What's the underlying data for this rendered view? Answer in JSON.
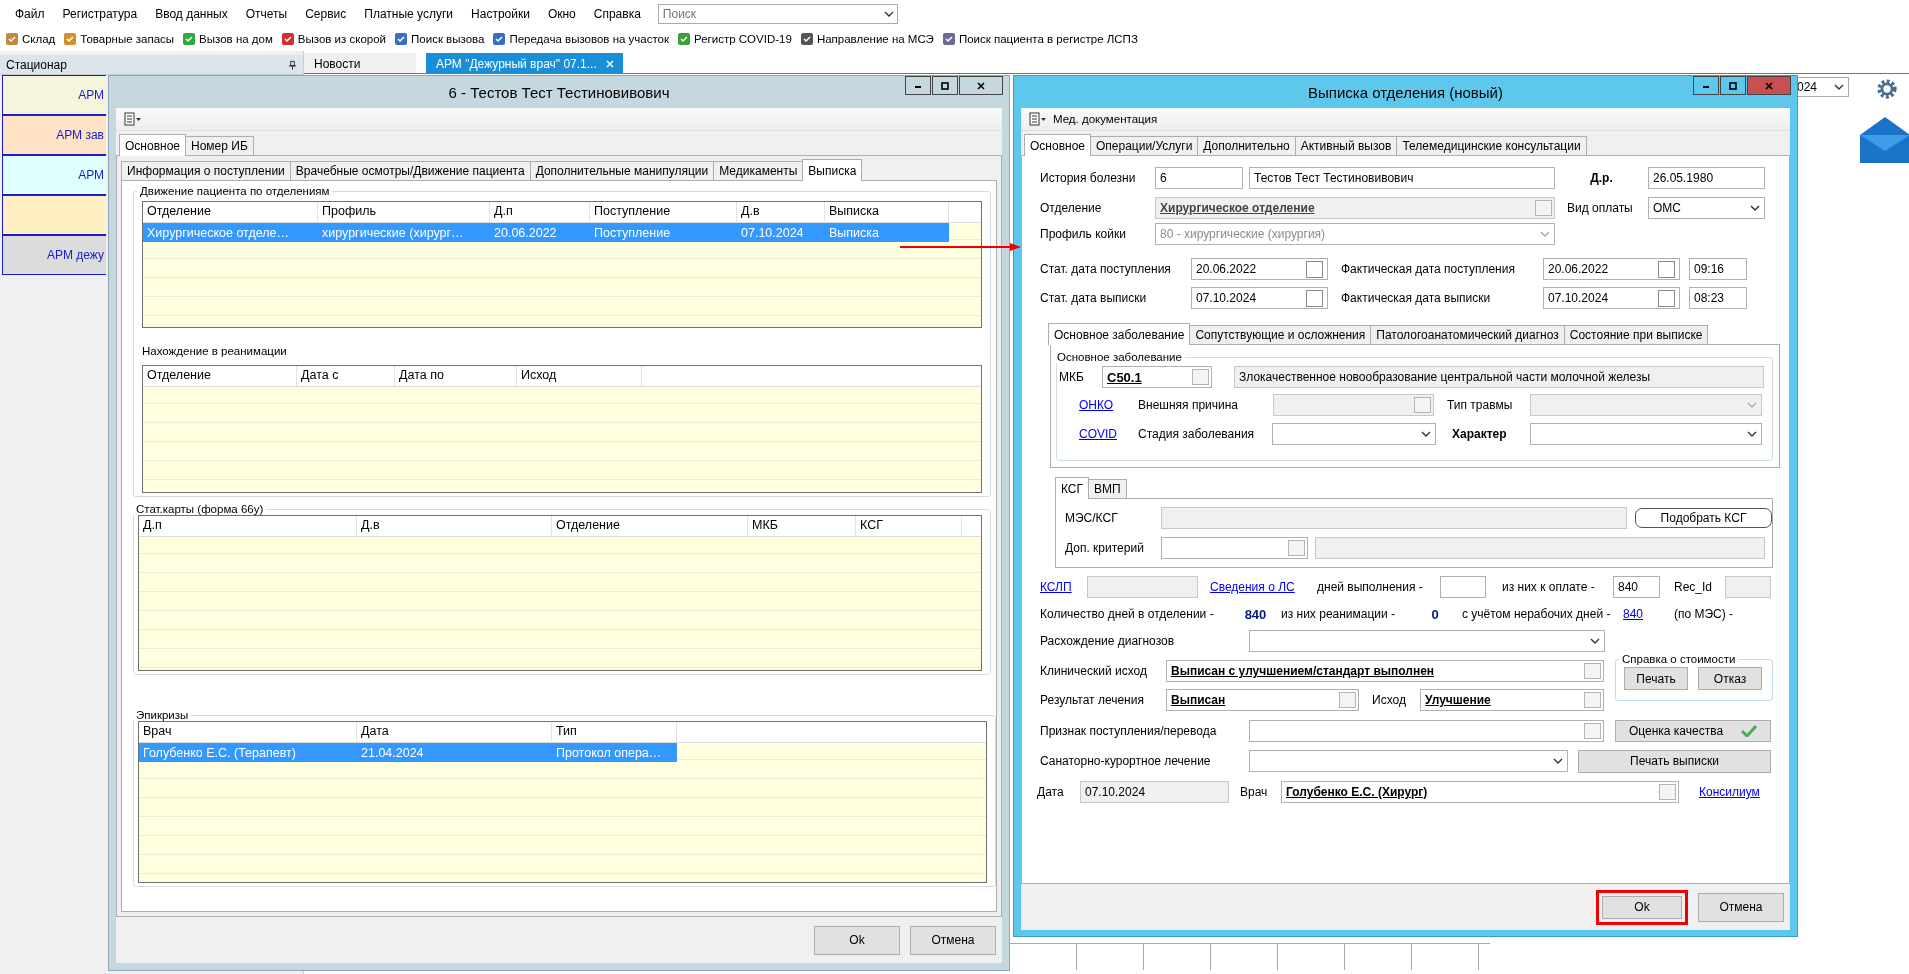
{
  "menu": [
    "Файл",
    "Регистратура",
    "Ввод данных",
    "Отчеты",
    "Сервис",
    "Платные услуги",
    "Настройки",
    "Окно",
    "Справка"
  ],
  "search": {
    "placeholder": "Поиск"
  },
  "toolbar": [
    "Склад",
    "Товарные запасы",
    "Вызов на дом",
    "Вызов из скорой",
    "Поиск вызова",
    "Передача вызовов на участок",
    "Регистр COVID-19",
    "Направление на МСЭ",
    "Поиск пациента в регистре ЛСПЗ"
  ],
  "side_panel": {
    "title": "Стационар",
    "items": [
      {
        "label": "АРМ",
        "color": "#f5f5dc"
      },
      {
        "label": "АРМ зав",
        "color": "#fde3c3"
      },
      {
        "label": "АРМ",
        "color": "#e0ffff"
      },
      {
        "color": "#fff0c4"
      },
      {
        "label": "АРМ дежу",
        "color": "#dcdcdc"
      }
    ]
  },
  "doc_tabs": [
    {
      "label": "Новости",
      "selected": false
    },
    {
      "label": "АРМ \"Дежурный врач\" 07.1...",
      "selected": true
    }
  ],
  "date_combo": {
    "value": "024"
  },
  "patient_window": {
    "title": "6 - Тестов Тест Тестиновивович",
    "tabs": [
      {
        "label": "Основное",
        "selected": true
      },
      {
        "label": "Номер ИБ",
        "selected": false
      }
    ],
    "subtabs": [
      {
        "label": "Информация о поступлении",
        "selected": false
      },
      {
        "label": "Врачебные осмотры/Движение пациента",
        "selected": false
      },
      {
        "label": "Дополнительные манипуляции",
        "selected": false
      },
      {
        "label": "Медикаменты",
        "selected": false
      },
      {
        "label": "Выписка",
        "selected": true
      }
    ],
    "movement": {
      "title": "Движение пациента по отделениям",
      "columns": [
        "Отделение",
        "Профиль",
        "Д.п",
        "Поступление",
        "Д.в",
        "Выписка"
      ],
      "rows": [
        {
          "cells": [
            "Хирургическое отделе…",
            "хирургические (хирург…",
            "20.06.2022",
            "Поступление",
            "07.10.2024",
            "Выписка"
          ],
          "selected": true
        }
      ]
    },
    "reanimation": {
      "title": "Нахождение в реанимации",
      "columns": [
        "Отделение",
        "Дата с",
        "Дата по",
        "Исход"
      ]
    },
    "stat_cards": {
      "title": "Стат.карты (форма 66у)",
      "columns": [
        "Д.п",
        "Д.в",
        "Отделение",
        "МКБ",
        "КСГ"
      ]
    },
    "epicrises": {
      "title": "Эпикризы",
      "columns": [
        "Врач",
        "Дата",
        "Тип"
      ],
      "rows": [
        {
          "cells": [
            "Голубенко Е.С. (Терапевт)",
            "21.04.2024",
            "Протокол опера…"
          ],
          "selected": true
        }
      ]
    },
    "buttons": [
      "Ok",
      "Отмена"
    ]
  },
  "discharge_window": {
    "title": "Выписка отделения (новый)",
    "menu_label": "Мед. документация",
    "tabs": [
      {
        "label": "Основное",
        "selected": true
      },
      {
        "label": "Операции/Услуги",
        "selected": false
      },
      {
        "label": "Дополнительно",
        "selected": false
      },
      {
        "label": "Активный вызов",
        "selected": false
      },
      {
        "label": "Телемедицинские консультации",
        "selected": false
      }
    ],
    "history": {
      "label": "История болезни",
      "number": "6",
      "patient": "Тестов Тест Тестиновивович"
    },
    "birth_date": {
      "label": "Д.р.",
      "value": "26.05.1980"
    },
    "department": {
      "label": "Отделение",
      "value": "Хирургическое отделение",
      "disabled": true
    },
    "payment": {
      "label": "Вид оплаты",
      "value": "ОМС"
    },
    "bed_profile": {
      "label": "Профиль койки",
      "value": "80 - хирургические (хирургия)",
      "disabled": true
    },
    "dates": [
      {
        "label": "Стат. дата поступления",
        "value": "20.06.2022",
        "actual_label": "Фактическая дата поступления",
        "actual_value": "20.06.2022",
        "time": "09:16"
      },
      {
        "label": "Стат. дата выписки",
        "value": "07.10.2024",
        "actual_label": "Фактическая дата выписки",
        "actual_value": "07.10.2024",
        "time": "08:23"
      }
    ],
    "diagnosis_tabs": [
      {
        "label": "Основное заболевание",
        "selected": true
      },
      {
        "label": "Сопутствующие и осложнения",
        "selected": false
      },
      {
        "label": "Патологоанатомический диагноз",
        "selected": false
      },
      {
        "label": "Состояние при выписке",
        "selected": false
      }
    ],
    "diagnosis": {
      "title": "Основное заболевание",
      "mkb_label": "МКБ",
      "mkb_code": "C50.1",
      "mkb_name": "Злокачественное новообразование центральной части молочной железы",
      "onko_link": "ОНКО",
      "external_cause_label": "Внешняя причина",
      "injury_label": "Тип травмы",
      "covid_link": "COVID",
      "stage_label": "Стадия заболевания",
      "character_label": "Характер"
    },
    "ksg_tabs": [
      {
        "label": "КСГ",
        "selected": true
      },
      {
        "label": "ВМП",
        "selected": false
      }
    ],
    "ksg": {
      "mes_label": "МЭС/КСГ",
      "pick_button": "Подобрать КСГ",
      "criterion_label": "Доп. критерий"
    },
    "kslp_link": "КСЛП",
    "drugs_link": "Сведения о ЛС",
    "exec_days_label": "дней выполнения -",
    "paid_label": "из них к оплате -",
    "paid_value": "840",
    "rec_id_label": "Rec_Id",
    "days": {
      "label": "Количество дней в отделении -",
      "value": "840",
      "reanimation_label": "из них реанимации -",
      "reanimation_value": "0",
      "nonworking_label": "с учётом нерабочих дней -",
      "nonworking_value": "840",
      "mes_label": "(по МЭС) -"
    },
    "discrepancy_label": "Расхождение диагнозов",
    "clinical_outcome": {
      "label": "Клинический исход",
      "value": "Выписан с улучшением/стандарт выполнен"
    },
    "cost_certificate": {
      "title": "Справка о стоимости",
      "buttons": [
        "Печать",
        "Отказ"
      ]
    },
    "treatment_result": {
      "label": "Результат лечения",
      "value": "Выписан"
    },
    "outcome": {
      "label": "Исход",
      "value": "Улучшение"
    },
    "admission_sign_label": "Признак поступления/перевода",
    "quality_button": "Оценка качества",
    "sanatorium_label": "Санаторно-курортное лечение",
    "print_button": "Печать выписки",
    "date": {
      "label": "Дата",
      "value": "07.10.2024"
    },
    "doctor": {
      "label": "Врач",
      "value": "Голубенко Е.С. (Хирург)"
    },
    "consilium_link": "Консилиум",
    "buttons": [
      {
        "label": "Ok",
        "highlighted": true
      },
      {
        "label": "Отмена",
        "highlighted": false
      }
    ]
  }
}
